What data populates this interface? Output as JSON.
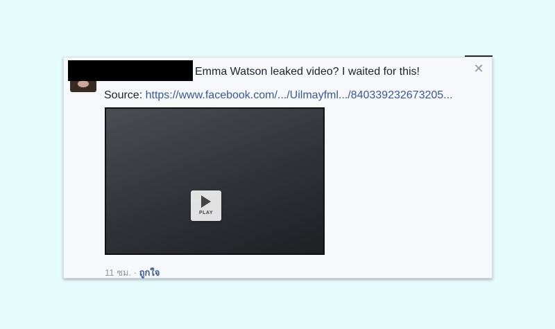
{
  "post": {
    "headline": "Emma Watson leaked video? I waited for this!",
    "source_label": "Source: ",
    "source_url": "https://www.facebook.com/.../Uilmayfml.../840339232673205...",
    "close_symbol": "✕",
    "video": {
      "play_label": "PLAY"
    },
    "timestamp": "11 ชม.",
    "separator": " · ",
    "like_label": "ถูกใจ"
  },
  "colors": {
    "background": "#e6fbfb",
    "card": "#f7f8fa",
    "link": "#365899",
    "text": "#1d2129",
    "muted": "#90949c"
  },
  "icons": {
    "close": "close-icon",
    "play": "play-icon"
  }
}
